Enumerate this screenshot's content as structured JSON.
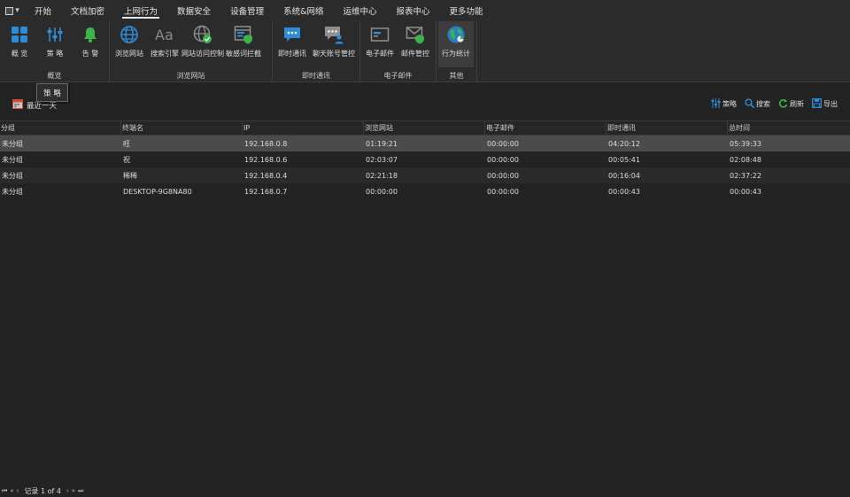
{
  "menu": {
    "app_icon": "window-menu-icon",
    "tabs": [
      "开始",
      "文档加密",
      "上网行为",
      "数据安全",
      "设备管理",
      "系统&网络",
      "运维中心",
      "报表中心",
      "更多功能"
    ],
    "active_tab": "上网行为"
  },
  "ribbon": {
    "groups": [
      {
        "label": "概览",
        "buttons": [
          {
            "label": "概 览",
            "icon": "grid-icon"
          },
          {
            "label": "策 略",
            "icon": "sliders-icon"
          },
          {
            "label": "告 警",
            "icon": "bell-icon"
          }
        ]
      },
      {
        "label": "浏览网站",
        "buttons": [
          {
            "label": "浏览网站",
            "icon": "globe-icon"
          },
          {
            "label": "搜索引擎",
            "icon": "font-aa-icon"
          },
          {
            "label": "网站访问控制",
            "icon": "globe-check-icon"
          },
          {
            "label": "敏感词拦截",
            "icon": "window-shield-icon"
          }
        ]
      },
      {
        "label": "即时通讯",
        "buttons": [
          {
            "label": "即时通讯",
            "icon": "chat-bubble-icon"
          },
          {
            "label": "聊天账号管控",
            "icon": "chat-user-icon"
          }
        ]
      },
      {
        "label": "电子邮件",
        "buttons": [
          {
            "label": "电子邮件",
            "icon": "email-card-icon"
          },
          {
            "label": "邮件管控",
            "icon": "envelope-shield-icon"
          }
        ]
      },
      {
        "label": "其他",
        "buttons": [
          {
            "label": "行为统计",
            "icon": "globe-stats-icon"
          }
        ]
      }
    ]
  },
  "tooltip": "策 略",
  "toolbar": {
    "date_range_label": "最近一天",
    "actions": [
      {
        "label": "策略",
        "icon": "sliders-icon"
      },
      {
        "label": "搜索",
        "icon": "search-icon"
      },
      {
        "label": "刷新",
        "icon": "refresh-icon"
      },
      {
        "label": "导出",
        "icon": "save-icon"
      }
    ]
  },
  "table": {
    "columns": [
      "分组",
      "终端名",
      "IP",
      "浏览网站",
      "电子邮件",
      "即时通讯",
      "总时间"
    ],
    "rows": [
      [
        "未分组",
        "旺",
        "192.168.0.8",
        "01:19:21",
        "00:00:00",
        "04:20:12",
        "05:39:33"
      ],
      [
        "未分组",
        "祝",
        "192.168.0.6",
        "02:03:07",
        "00:00:00",
        "00:05:41",
        "02:08:48"
      ],
      [
        "未分组",
        "稀稀",
        "192.168.0.4",
        "02:21:18",
        "00:00:00",
        "00:16:04",
        "02:37:22"
      ],
      [
        "未分组",
        "DESKTOP-9G8NA80",
        "192.168.0.7",
        "00:00:00",
        "00:00:00",
        "00:00:43",
        "00:00:43"
      ]
    ],
    "selected_row": 0
  },
  "status": {
    "record_text": "记录 1 of 4"
  },
  "colors": {
    "background": "#232323",
    "ribbon": "#2b2b2b",
    "icon_blue": "#2e8bd8",
    "icon_green": "#3cb44b",
    "selected_row": "#4b4b4b"
  }
}
